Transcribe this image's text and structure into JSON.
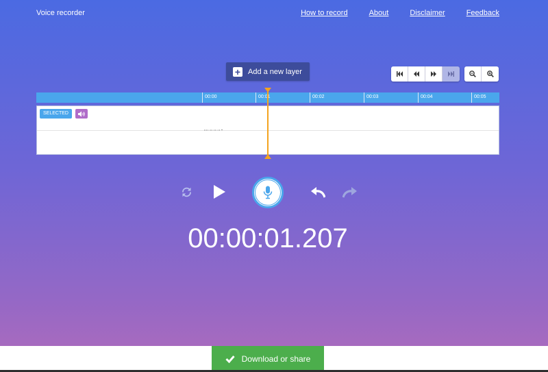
{
  "header": {
    "app_title": "Voice recorder",
    "nav": [
      "How to record",
      "About",
      "Disclaimer",
      "Feedback"
    ]
  },
  "toolbar": {
    "add_layer_label": "Add a new layer",
    "transport_icons": [
      "skip-to-start-icon",
      "rewind-icon",
      "fast-forward-icon",
      "skip-to-end-icon"
    ],
    "zoom_icons": [
      "zoom-out-icon",
      "zoom-in-icon"
    ]
  },
  "timeline": {
    "ticks": [
      "00:00",
      "00:01",
      "00:02",
      "00:03",
      "00:04",
      "00:05"
    ],
    "track_badge": "SELECTED",
    "playhead_time": 1.207
  },
  "controls": {
    "icons": [
      "refresh-icon",
      "play-icon",
      "microphone-icon",
      "undo-icon",
      "redo-icon"
    ]
  },
  "timer": {
    "value": "00:00:01.207"
  },
  "footer": {
    "download_label": "Download or share"
  },
  "colors": {
    "accent_blue": "#4aa6ec",
    "playhead": "#f4a31f",
    "download_green": "#4cae4c",
    "volume_badge": "#b06cc9"
  }
}
